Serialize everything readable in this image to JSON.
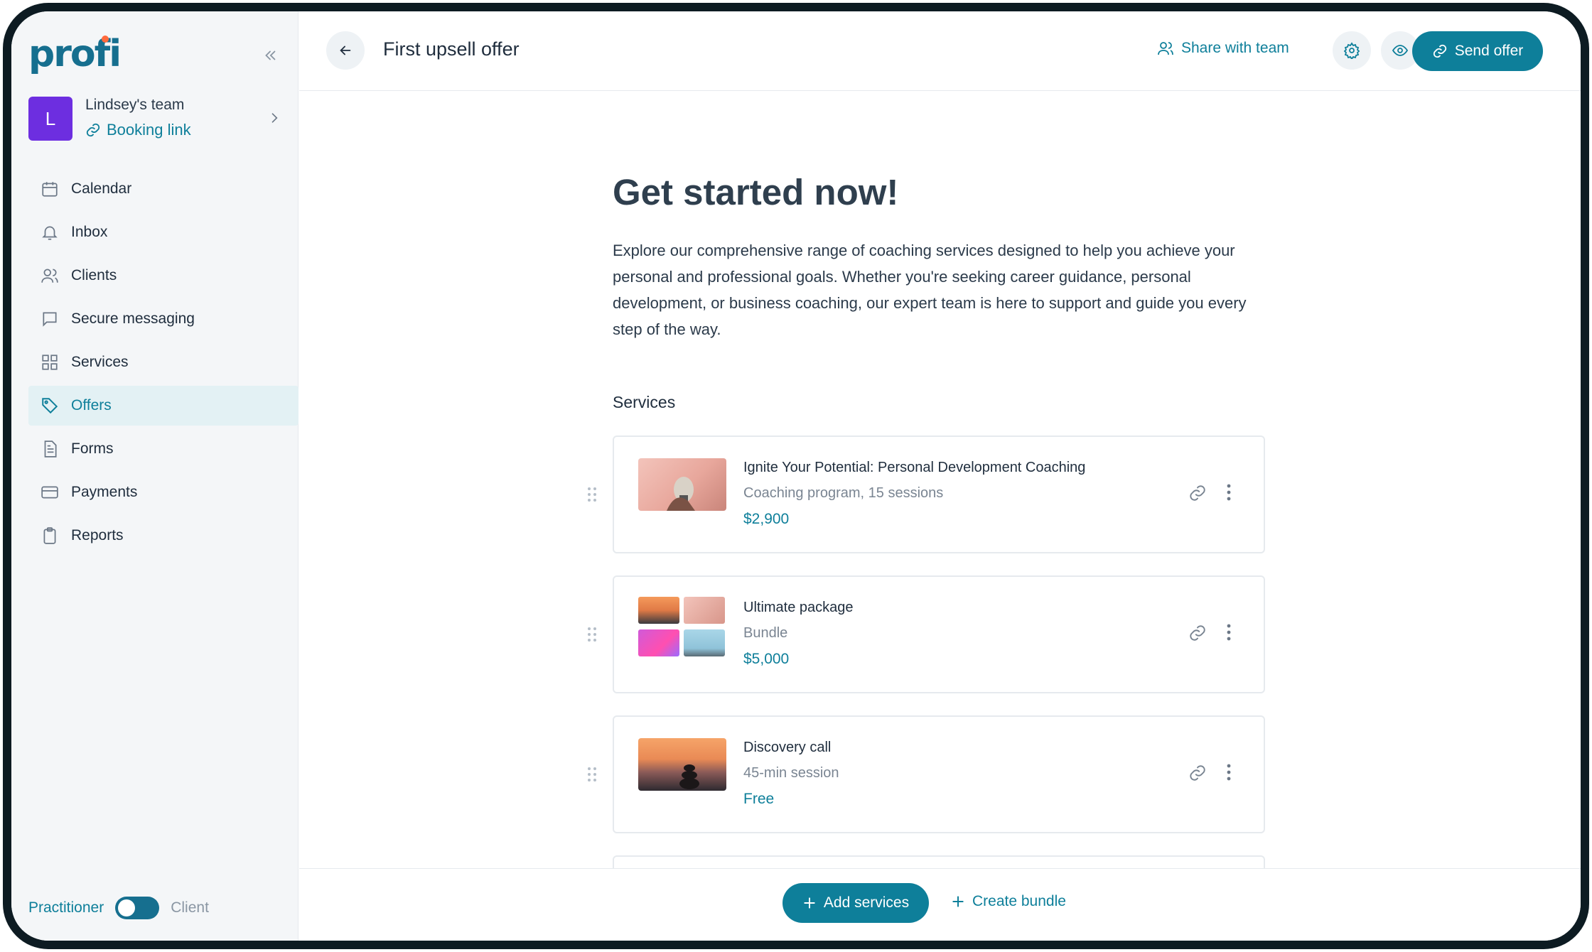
{
  "app": {
    "logo_text": "profi"
  },
  "team": {
    "initial": "L",
    "name": "Lindsey's team",
    "booking_label": "Booking link"
  },
  "nav": {
    "items": [
      {
        "label": "Calendar",
        "icon": "calendar-icon"
      },
      {
        "label": "Inbox",
        "icon": "bell-icon"
      },
      {
        "label": "Clients",
        "icon": "users-icon"
      },
      {
        "label": "Secure messaging",
        "icon": "message-icon"
      },
      {
        "label": "Services",
        "icon": "grid-icon"
      },
      {
        "label": "Offers",
        "icon": "tag-icon",
        "active": true
      },
      {
        "label": "Forms",
        "icon": "document-icon"
      },
      {
        "label": "Payments",
        "icon": "card-icon"
      },
      {
        "label": "Reports",
        "icon": "clipboard-icon"
      }
    ]
  },
  "mode": {
    "left": "Practitioner",
    "right": "Client",
    "selected": "Practitioner"
  },
  "header": {
    "title": "First upsell offer",
    "share_label": "Share with team",
    "send_label": "Send offer"
  },
  "main": {
    "title": "Get started now!",
    "description": "Explore our comprehensive range of coaching services designed to help you achieve your personal and professional goals. Whether you're seeking career guidance, personal development, or business coaching, our expert team is here to support and guide you every step of the way.",
    "services_heading": "Services",
    "services": [
      {
        "title": "Ignite Your Potential: Personal Development Coaching",
        "subtitle": "Coaching program, 15 sessions",
        "price": "$2,900"
      },
      {
        "title": "Ultimate package",
        "subtitle": "Bundle",
        "price": "$5,000"
      },
      {
        "title": "Discovery call",
        "subtitle": "45-min session",
        "price": "Free"
      }
    ]
  },
  "footer": {
    "add_label": "Add services",
    "bundle_label": "Create bundle"
  },
  "colors": {
    "accent": "#0e7f9a",
    "brand": "#166f8f",
    "avatar": "#6d2ee0",
    "logo_dot": "#ff6a3d"
  }
}
